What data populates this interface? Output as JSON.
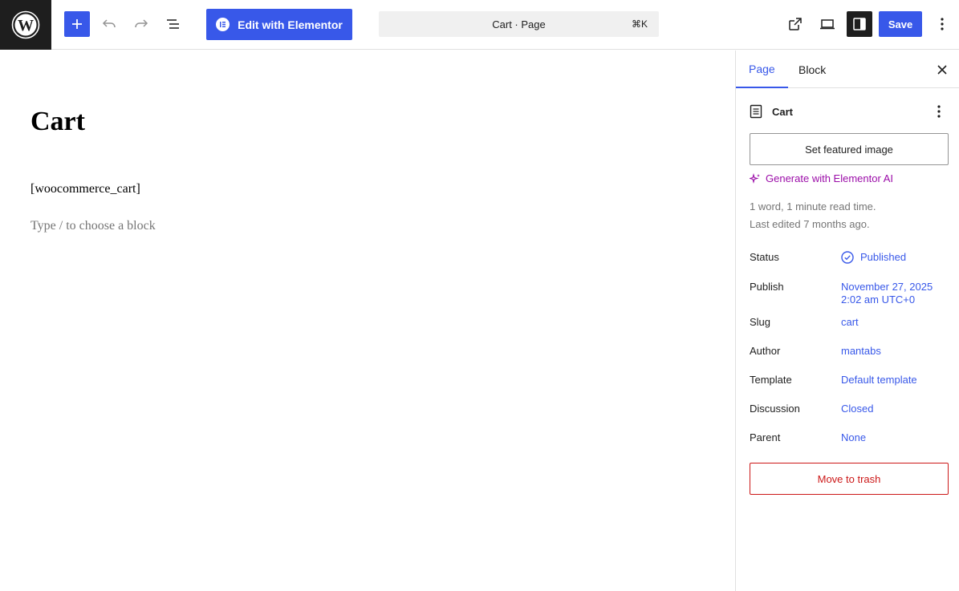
{
  "toolbar": {
    "logo_icon": "wordpress-logo",
    "add_icon": "plus-icon",
    "undo_icon": "undo-icon",
    "redo_icon": "redo-icon",
    "list_view_icon": "list-view-icon",
    "elementor_label": "Edit with Elementor",
    "command_bar_label": "Cart · Page",
    "command_shortcut": "⌘K",
    "view_icon": "external-link-icon",
    "preview_icon": "desktop-icon",
    "settings_icon": "sidebar-toggle-icon",
    "save_label": "Save",
    "more_icon": "vertical-ellipsis-icon"
  },
  "canvas": {
    "title": "Cart",
    "shortcode": "[woocommerce_cart]",
    "placeholder": "Type / to choose a block"
  },
  "sidebar": {
    "tabs": [
      {
        "label": "Page",
        "active": true
      },
      {
        "label": "Block",
        "active": false
      }
    ],
    "document_title": "Cart",
    "featured_image_label": "Set featured image",
    "ai_label": "Generate with Elementor AI",
    "meta_words": "1 word, 1 minute read time.",
    "meta_edited": "Last edited 7 months ago.",
    "properties": {
      "status": {
        "label": "Status",
        "value": "Published"
      },
      "publish": {
        "label": "Publish",
        "value_line1": "November 27, 2025",
        "value_line2": "2:02 am UTC+0"
      },
      "slug": {
        "label": "Slug",
        "value": "cart"
      },
      "author": {
        "label": "Author",
        "value": "mantabs"
      },
      "template": {
        "label": "Template",
        "value": "Default template"
      },
      "discussion": {
        "label": "Discussion",
        "value": "Closed"
      },
      "parent": {
        "label": "Parent",
        "value": "None"
      }
    },
    "trash_label": "Move to trash"
  },
  "colors": {
    "accent": "#3858e9",
    "ai": "#9b0ca8",
    "danger": "#cc1818",
    "dark": "#1e1e1e"
  }
}
